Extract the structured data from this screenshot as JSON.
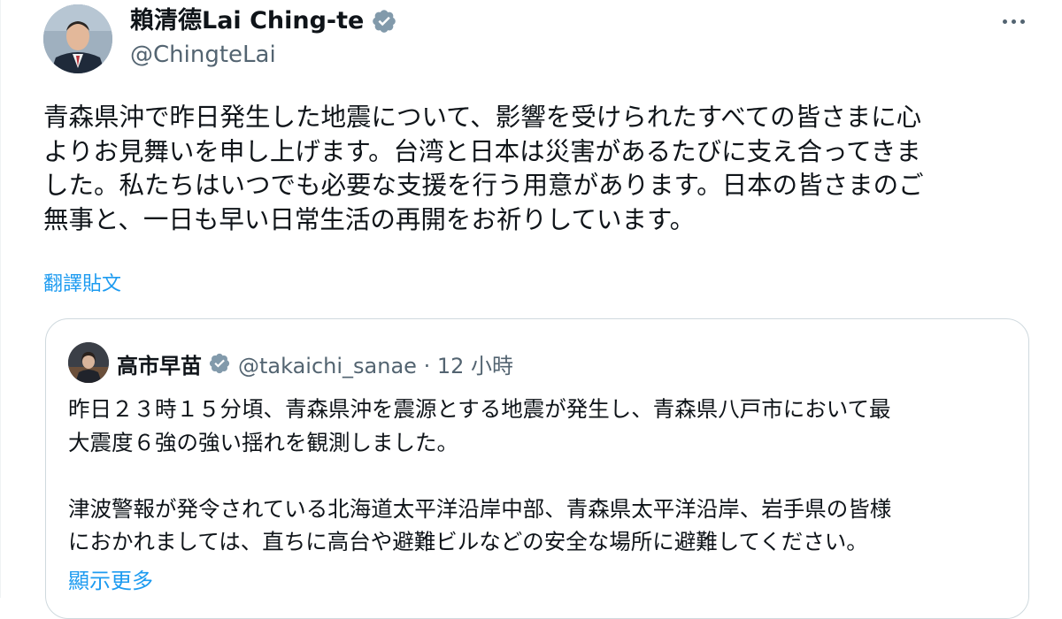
{
  "author": {
    "name": "賴清德Lai Ching-te",
    "handle": "@ChingteLai"
  },
  "more_icon": "more-horizontal-icon",
  "tweet": {
    "lines": [
      "青森県沖で昨日発生した地震について、影響を受けられたすべての皆さまに心",
      "よりお見舞いを申し上げます。台湾と日本は災害があるたびに支え合ってきま",
      "した。私たちはいつでも必要な支援を行う用意があります。日本の皆さまのご",
      "無事と、一日も早い日常生活の再開をお祈りしています。"
    ],
    "translate_label": "翻譯貼文"
  },
  "quoted": {
    "name": "高市早苗",
    "handle_time": "@takaichi_sanae · 12 小時",
    "lines": [
      "昨日２３時１５分頃、青森県沖を震源とする地震が発生し、青森県八戸市において最",
      "大震度６強の強い揺れを観測しました。",
      "",
      "津波警報が発令されている北海道太平洋沿岸中部、青森県太平洋沿岸、岩手県の皆様",
      "におかれましては、直ちに高台や避難ビルなどの安全な場所に避難してください。"
    ],
    "show_more_label": "顯示更多"
  },
  "colors": {
    "accent": "#1d9bf0",
    "verified_badge": "#829aab",
    "text": "#0f1419",
    "muted": "#536471",
    "border": "#cfd9de"
  }
}
